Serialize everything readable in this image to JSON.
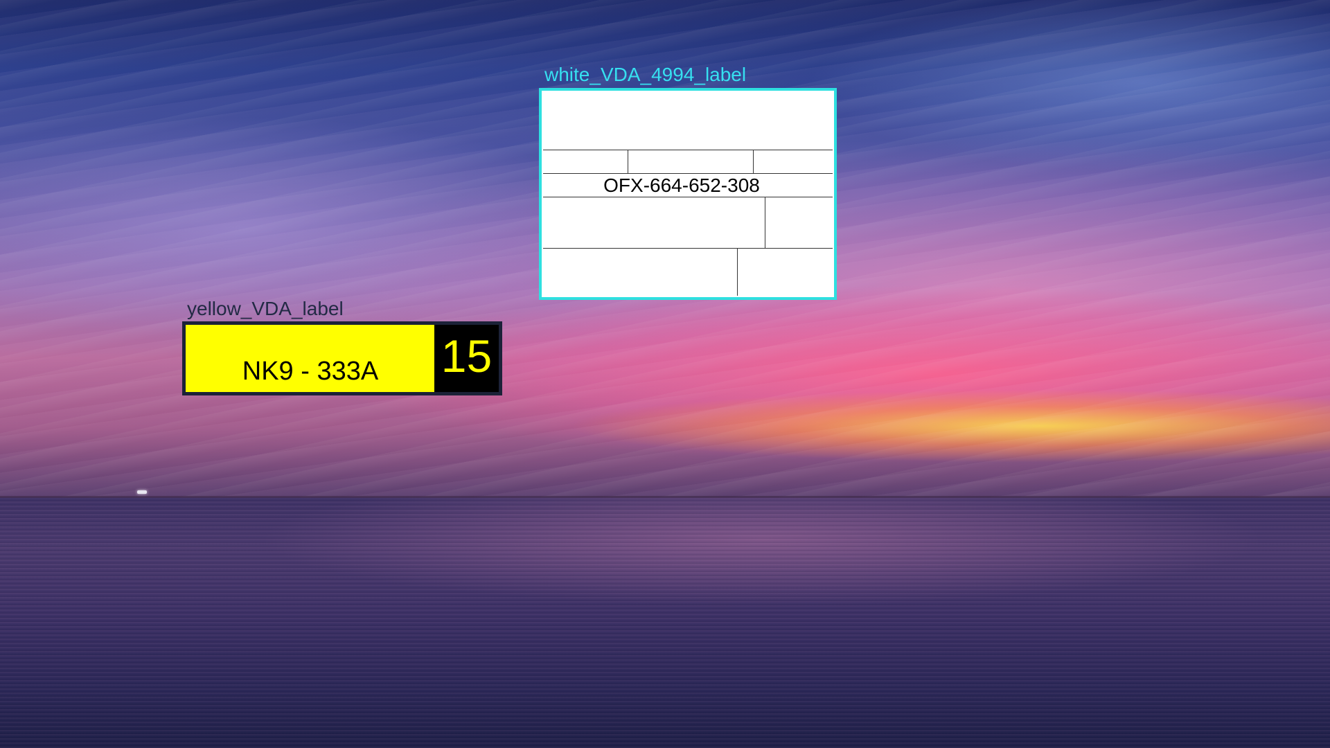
{
  "labels": {
    "white": {
      "caption": "white_VDA_4994_label",
      "caption_color": "#36e0f0",
      "border_color": "#2ee0e0",
      "code": "OFX-664-652-308"
    },
    "yellow": {
      "caption": "yellow_VDA_label",
      "caption_color": "#222a44",
      "plate": "NK9 - 333A",
      "count": "15",
      "background_color": "#ffff00",
      "count_background": "#000000"
    }
  }
}
